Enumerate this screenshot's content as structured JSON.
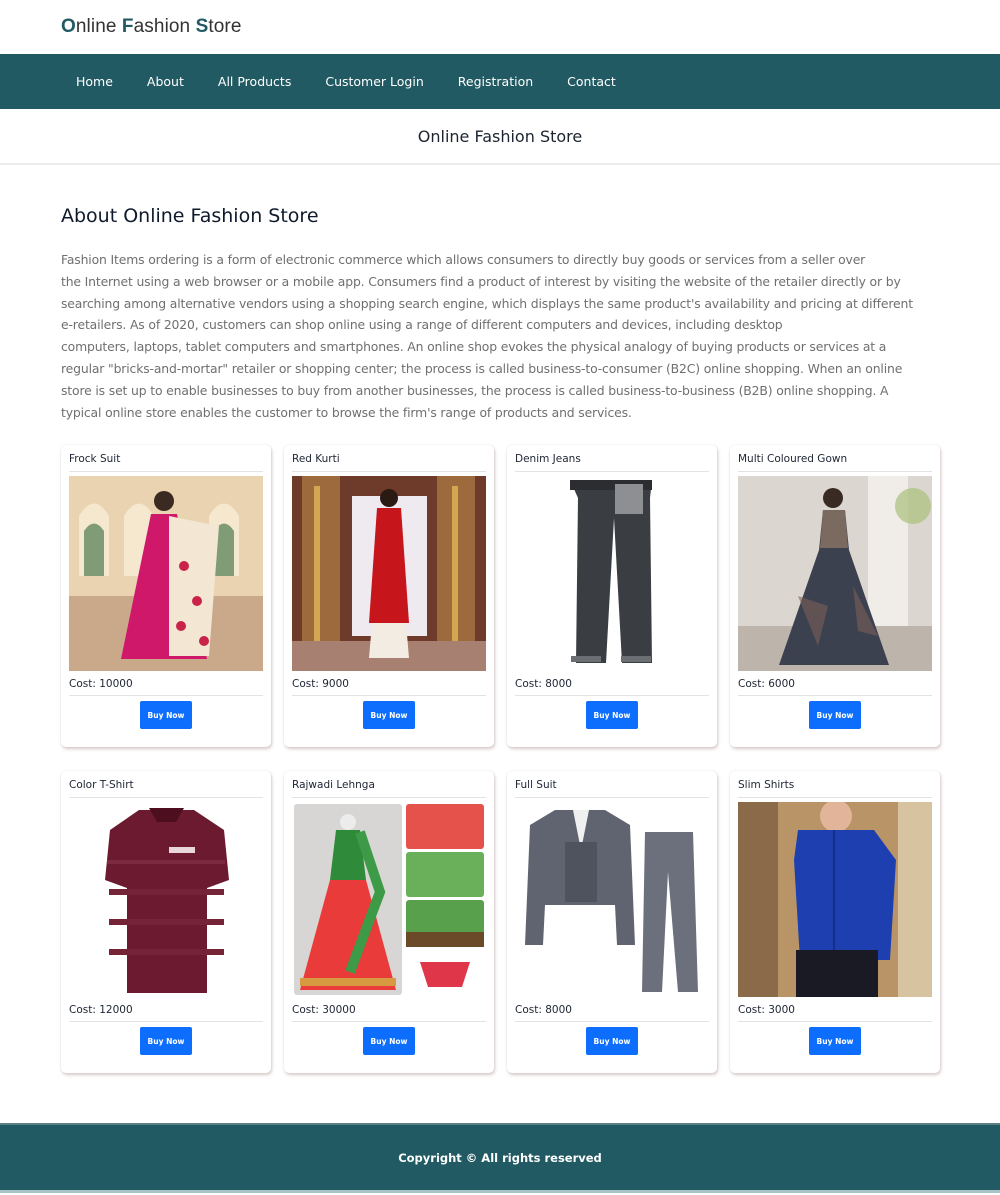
{
  "brand": {
    "first": "O",
    "w1": "nline ",
    "f": "F",
    "w2": "ashion ",
    "s": "S",
    "w3": "tore"
  },
  "nav": {
    "items": [
      {
        "label": "Home"
      },
      {
        "label": "About"
      },
      {
        "label": "All Products"
      },
      {
        "label": "Customer Login"
      },
      {
        "label": "Registration"
      },
      {
        "label": "Contact"
      }
    ]
  },
  "page_title": "Online Fashion Store",
  "about": {
    "heading": "About Online Fashion Store",
    "lines": [
      "Fashion Items ordering is a form of electronic commerce which allows consumers to directly buy goods or services from a seller over",
      "the Internet using a web browser or a mobile app. Consumers find a product of interest by visiting the website of the retailer directly or by",
      "searching among alternative vendors using a shopping search engine, which displays the same product's availability and pricing at different",
      "e-retailers. As of 2020, customers can shop online using a range of different computers and devices, including desktop",
      "computers, laptops, tablet computers and smartphones. An online shop evokes the physical analogy of buying products or services at a",
      "regular \"bricks-and-mortar\" retailer or shopping center; the process is called business-to-consumer (B2C) online shopping. When an online",
      "store is set up to enable businesses to buy from another businesses, the process is called business-to-business (B2B) online shopping. A",
      "typical online store enables the customer to browse the firm's range of products and services."
    ]
  },
  "products": [
    {
      "name": "Frock Suit",
      "cost": "Cost: 10000",
      "button": "Buy Now",
      "image": "frock-suit-image"
    },
    {
      "name": "Red Kurti",
      "cost": "Cost: 9000",
      "button": "Buy Now",
      "image": "red-kurti-image"
    },
    {
      "name": "Denim Jeans",
      "cost": "Cost: 8000",
      "button": "Buy Now",
      "image": "denim-jeans-image"
    },
    {
      "name": "Multi Coloured Gown",
      "cost": "Cost: 6000",
      "button": "Buy Now",
      "image": "gown-image"
    },
    {
      "name": "Color T-Shirt",
      "cost": "Cost: 12000",
      "button": "Buy Now",
      "image": "tshirt-image"
    },
    {
      "name": "Rajwadi Lehnga",
      "cost": "Cost: 30000",
      "button": "Buy Now",
      "image": "lehnga-image"
    },
    {
      "name": "Full Suit",
      "cost": "Cost: 8000",
      "button": "Buy Now",
      "image": "full-suit-image"
    },
    {
      "name": "Slim Shirts",
      "cost": "Cost: 3000",
      "button": "Buy Now",
      "image": "slim-shirt-image"
    }
  ],
  "footer": {
    "text": "Copyright © All rights reserved"
  },
  "colors": {
    "primary": "#215a63",
    "button": "#0d6efd"
  }
}
